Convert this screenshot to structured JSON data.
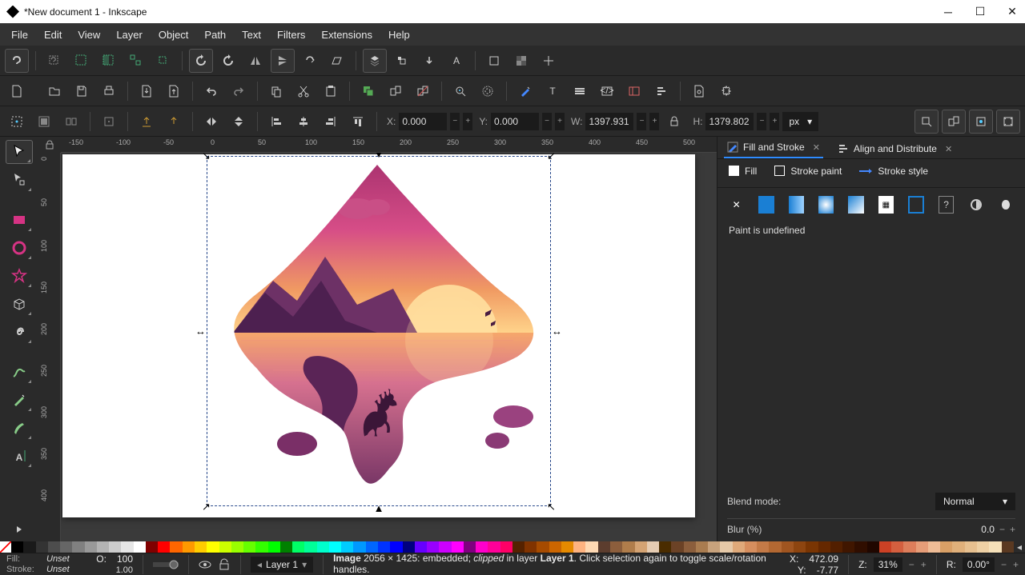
{
  "window": {
    "title": "*New document 1 - Inkscape"
  },
  "menu": {
    "items": [
      "File",
      "Edit",
      "View",
      "Layer",
      "Object",
      "Path",
      "Text",
      "Filters",
      "Extensions",
      "Help"
    ]
  },
  "coords": {
    "X_lbl": "X:",
    "X": "0.000",
    "Y_lbl": "Y:",
    "Y": "0.000",
    "W_lbl": "W:",
    "W": "1397.931",
    "H_lbl": "H:",
    "H": "1379.802",
    "unit": "px"
  },
  "ruler_h": [
    "-150",
    "-100",
    "-50",
    "0",
    "50",
    "100",
    "150",
    "200",
    "250",
    "300",
    "350",
    "400",
    "450",
    "500"
  ],
  "ruler_v": [
    "0",
    "50",
    "100",
    "150",
    "200",
    "250",
    "300",
    "350",
    "400"
  ],
  "panel": {
    "tab1": "Fill and Stroke",
    "tab2": "Align and Distribute",
    "sub_fill": "Fill",
    "sub_stroke": "Stroke paint",
    "sub_style": "Stroke style",
    "msg": "Paint is undefined",
    "blend_lbl": "Blend mode:",
    "blend_val": "Normal",
    "blur_lbl": "Blur (%)",
    "blur_val": "0.0"
  },
  "status": {
    "fill_lbl": "Fill:",
    "fill_val": "Unset",
    "stroke_lbl": "Stroke:",
    "stroke_val": "Unset",
    "opacity_lbl": "O:",
    "opacity": "100",
    "stroke_w": "1.00",
    "layer": "Layer 1",
    "help_pre": "Image",
    "help_dim": " 2056 × 1425: embedded; ",
    "help_clip": "clipped",
    "help_mid": " in layer ",
    "help_layer": "Layer 1",
    "help_post": ". Click selection again to toggle scale/rotation handles.",
    "X_lbl": "X:",
    "X": "472.09",
    "Y_lbl": "Y:",
    "Y": "-7.77",
    "Z_lbl": "Z:",
    "zoom": "31%",
    "R_lbl": "R:",
    "rot": "0.00°"
  },
  "swatches": [
    "#000",
    "#1a1a1a",
    "#333",
    "#4d4d4d",
    "#666",
    "#808080",
    "#999",
    "#b3b3b3",
    "#ccc",
    "#e6e6e6",
    "#fff",
    "#800000",
    "#f00",
    "#ff6600",
    "#ff9900",
    "#ffcc00",
    "#ff0",
    "#ccff00",
    "#9f0",
    "#6f0",
    "#3f0",
    "#0f0",
    "#008000",
    "#0f6",
    "#0f9",
    "#0fc",
    "#0ff",
    "#0cf",
    "#09f",
    "#06f",
    "#03f",
    "#00f",
    "#000080",
    "#60f",
    "#90f",
    "#c0f",
    "#f0f",
    "#800080",
    "#f0c",
    "#f09",
    "#f06",
    "#552200",
    "#803300",
    "#a64b00",
    "#cc6600",
    "#e68a00",
    "#ffb380",
    "#ffd9b3",
    "#5c3d2e",
    "#8c5e3c",
    "#b07d4b",
    "#d4a373",
    "#e6ccb2",
    "#4a2c00",
    "#6b4226",
    "#8b5e3c",
    "#a97c50",
    "#c8a27c",
    "#e6c9a8",
    "#dfa97a",
    "#d68e5e",
    "#c47a47",
    "#b36832",
    "#a05520",
    "#8d4510",
    "#793503",
    "#652800",
    "#521f00",
    "#401600",
    "#300e00",
    "#200700",
    "#cc4125",
    "#d45f3f",
    "#dd7e5b",
    "#e69d78",
    "#efbc96",
    "#d9a066",
    "#e0b07a",
    "#e7c08f",
    "#eed0a4",
    "#f5e0b9",
    "#5a3921"
  ]
}
